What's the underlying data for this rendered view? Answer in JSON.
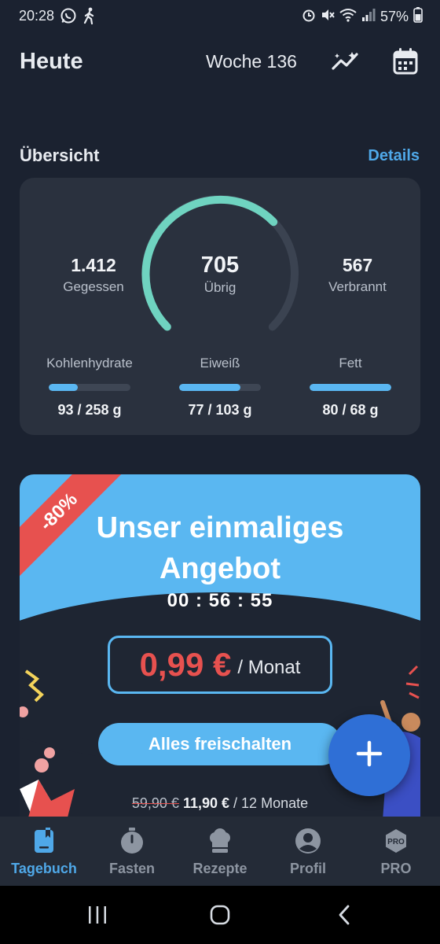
{
  "status_bar": {
    "time": "20:28",
    "battery": "57%",
    "icons": [
      "whatsapp-icon",
      "walking-icon",
      "alarm-icon",
      "mute-icon",
      "wifi-icon",
      "signal-icon",
      "battery-icon"
    ]
  },
  "header": {
    "title": "Heute",
    "week": "Woche 136",
    "icons": [
      "trend-icon",
      "calendar-icon"
    ]
  },
  "overview": {
    "title": "Übersicht",
    "details_link": "Details",
    "eaten_value": "1.412",
    "eaten_label": "Gegessen",
    "remaining_value": "705",
    "remaining_label": "Übrig",
    "burned_value": "567",
    "burned_label": "Verbrannt",
    "gauge_progress": 0.67,
    "macros": [
      {
        "name": "Kohlenhydrate",
        "value": "93 / 258 g",
        "progress": 0.36
      },
      {
        "name": "Eiweiß",
        "value": "77 / 103 g",
        "progress": 0.75
      },
      {
        "name": "Fett",
        "value": "80 / 68 g",
        "progress": 1.0
      }
    ]
  },
  "promo": {
    "badge": "-80%",
    "title_line1": "Unser einmaliges",
    "title_line2": "Angebot",
    "timer": "00 : 56 : 55",
    "price": "0,99 €",
    "price_period": "/ Monat",
    "cta": "Alles freischalten",
    "old_price": "59,90 €",
    "new_price": "11,90 €",
    "new_price_period": "/ 12 Monate"
  },
  "fab": {
    "icon": "plus-icon"
  },
  "bottom_nav": {
    "items": [
      {
        "label": "Tagebuch",
        "icon": "diary-icon",
        "active": true
      },
      {
        "label": "Fasten",
        "icon": "stopwatch-icon",
        "active": false
      },
      {
        "label": "Rezepte",
        "icon": "chef-hat-icon",
        "active": false
      },
      {
        "label": "Profil",
        "icon": "profile-icon",
        "active": false
      },
      {
        "label": "PRO",
        "icon": "pro-badge-icon",
        "active": false
      }
    ],
    "pro_badge_text": "PRO"
  },
  "colors": {
    "background": "#1b2230",
    "card": "#2a313e",
    "accent_blue": "#5ab7f1",
    "gauge_green": "#6fd3c0",
    "promo_red": "#e7514f",
    "fab_blue": "#2f6fd6"
  }
}
